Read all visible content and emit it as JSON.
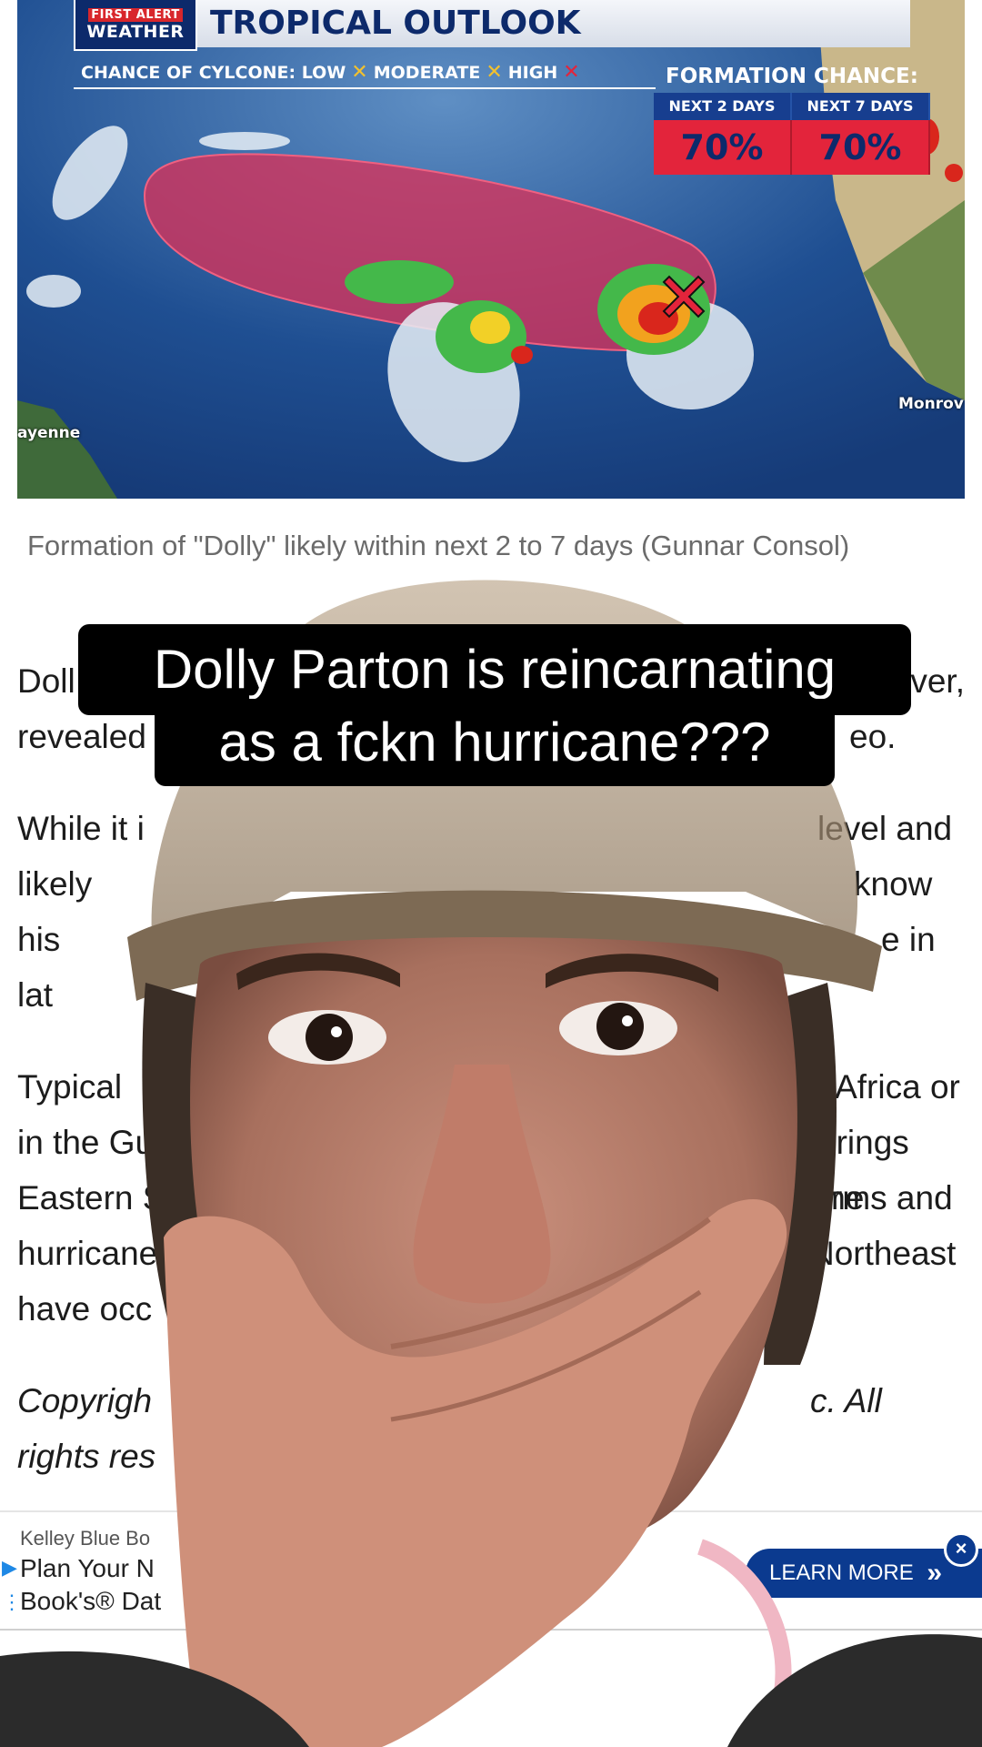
{
  "weather_graphic": {
    "logo_line1": "FIRST ALERT",
    "logo_line2": "WEATHER",
    "title": "TROPICAL OUTLOOK",
    "chance_label": "CHANCE OF CYLCONE:",
    "levels": [
      "LOW",
      "MODERATE",
      "HIGH"
    ],
    "level_colors": {
      "low": "#f2c12e",
      "moderate": "#f2c12e",
      "high": "#e3243b"
    },
    "formation_title": "FORMATION CHANCE:",
    "periods": [
      {
        "label": "NEXT 2 DAYS",
        "value": "70%"
      },
      {
        "label": "NEXT 7 DAYS",
        "value": "70%"
      }
    ],
    "place_left": "ayenne",
    "place_right": "Monrov"
  },
  "article": {
    "caption": "Formation of \"Dolly\" likely within next 2 to 7 days  (Gunnar Consol)",
    "paragraphs": [
      {
        "lines": [
          "Doll",
          "ver,"
        ],
        "lines2": [
          "revealed",
          "eo."
        ]
      },
      {
        "lines": [
          "While it i",
          "level and"
        ],
        "lines2": [
          "likely",
          "know"
        ],
        "lines3": [
          "his",
          "e in"
        ],
        "lines4": [
          "lat",
          ""
        ]
      },
      {
        "lines": [
          "Typical",
          "of Africa or"
        ],
        "lines2": [
          "in the Gu",
          "brings the"
        ],
        "lines3": [
          "Eastern S",
          "rms and"
        ],
        "lines4": [
          "hurricane",
          "Northeast"
        ],
        "lines5": [
          "have occ",
          ""
        ]
      },
      {
        "lines": [
          "Copyrigh",
          "c. All"
        ],
        "lines2": [
          "rights res",
          ""
        ]
      }
    ]
  },
  "ad": {
    "brand": "Kelley Blue Bo",
    "line1": "Plan Your N",
    "line2": "Book's® Dat",
    "cta": "LEARN MORE",
    "close": "×"
  },
  "overlay_caption": {
    "line1": "Dolly Parton is reincarnating",
    "line2": "as a fckn hurricane???"
  }
}
